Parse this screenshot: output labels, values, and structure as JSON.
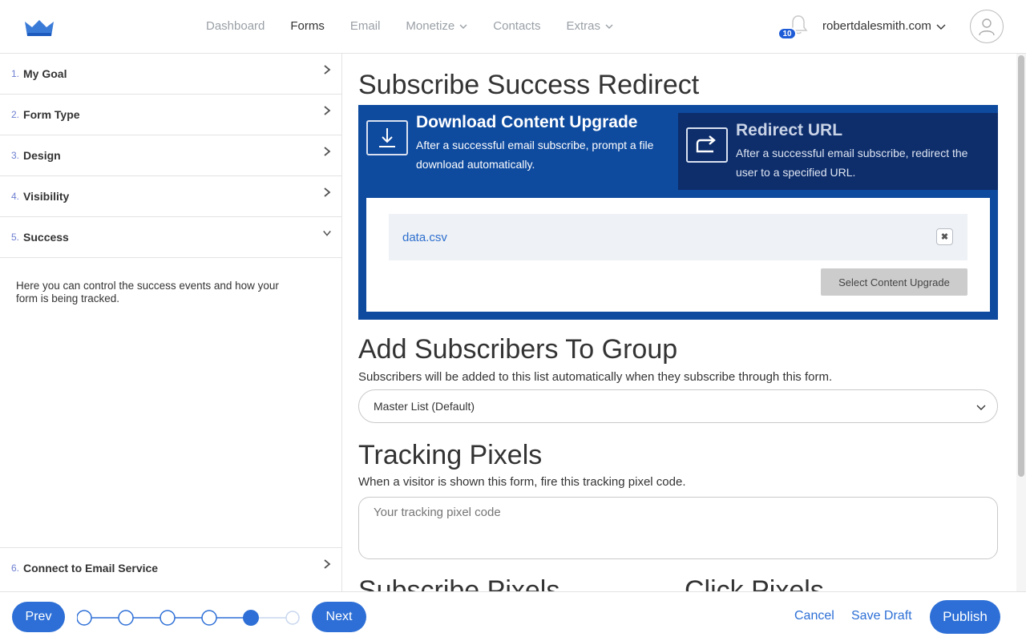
{
  "nav": {
    "items": [
      "Dashboard",
      "Forms",
      "Email",
      "Monetize",
      "Contacts",
      "Extras"
    ],
    "notifications_count": "10",
    "site": "robertdalesmith.com"
  },
  "sidebar": {
    "steps": [
      {
        "num": "1.",
        "label": "My Goal"
      },
      {
        "num": "2.",
        "label": "Form Type"
      },
      {
        "num": "3.",
        "label": "Design"
      },
      {
        "num": "4.",
        "label": "Visibility"
      },
      {
        "num": "5.",
        "label": "Success"
      },
      {
        "num": "6.",
        "label": "Connect to Email Service"
      }
    ],
    "description": "Here you can control the success events and how your form is being tracked."
  },
  "main": {
    "redirect_title": "Subscribe Success Redirect",
    "option_download": {
      "title": "Download Content Upgrade",
      "desc": "After a successful email subscribe, prompt a file download automatically."
    },
    "option_redirect": {
      "title": "Redirect URL",
      "desc": "After a successful email subscribe, redirect the user to a specified URL."
    },
    "file_name": "data.csv",
    "select_button": "Select Content Upgrade",
    "group_title": "Add Subscribers To Group",
    "group_desc": "Subscribers will be added to this list automatically when they subscribe through this form.",
    "group_value": "Master List (Default)",
    "pixels_title": "Tracking Pixels",
    "pixels_desc": "When a visitor is shown this form, fire this tracking pixel code.",
    "pixels_placeholder": "Your tracking pixel code",
    "subscribe_pixels_title": "Subscribe Pixels",
    "click_pixels_title": "Click Pixels"
  },
  "footer": {
    "prev": "Prev",
    "next": "Next",
    "cancel": "Cancel",
    "save_draft": "Save Draft",
    "publish": "Publish",
    "progress_current_step": 5,
    "progress_total_steps": 6
  },
  "colors": {
    "brand_blue": "#2d6fd6",
    "panel_blue": "#0e4a9e",
    "panel_dark": "#0d2d6b"
  }
}
